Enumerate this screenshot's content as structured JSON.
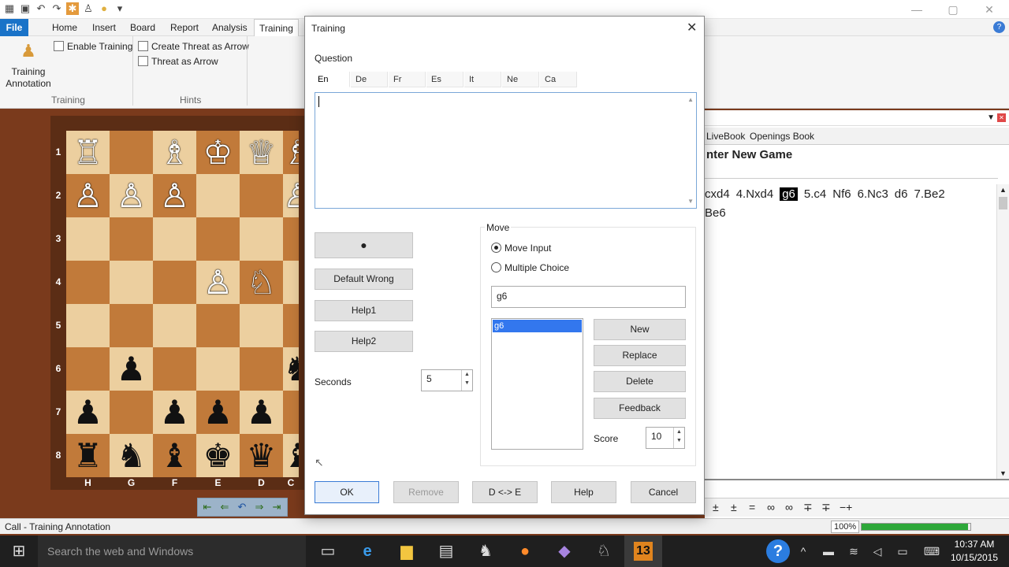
{
  "app": {
    "menu": [
      "File",
      "Home",
      "Insert",
      "Board",
      "Report",
      "Analysis",
      "Training"
    ],
    "ribbon": {
      "training_annotation": "Training Annotation",
      "enable_training": "Enable Training",
      "create_threat_arrow": "Create Threat as Arrow",
      "threat_as_arrow": "Threat as Arrow",
      "group_training": "Training",
      "group_hints": "Hints"
    },
    "status_text": "Call - Training Annotation",
    "zoom": "100%",
    "progress": 0.98
  },
  "board": {
    "ranks": [
      "1",
      "2",
      "3",
      "4",
      "5",
      "6",
      "7",
      "8"
    ],
    "files": [
      "H",
      "G",
      "F",
      "E",
      "D",
      "C"
    ],
    "pieces": [
      {
        "r": 0,
        "f": 0,
        "p": "♖",
        "c": "w"
      },
      {
        "r": 0,
        "f": 2,
        "p": "♗",
        "c": "w"
      },
      {
        "r": 0,
        "f": 3,
        "p": "♔",
        "c": "w"
      },
      {
        "r": 0,
        "f": 4,
        "p": "♕",
        "c": "w"
      },
      {
        "r": 0,
        "f": 5,
        "p": "♗",
        "c": "w"
      },
      {
        "r": 1,
        "f": 0,
        "p": "♙",
        "c": "w"
      },
      {
        "r": 1,
        "f": 1,
        "p": "♙",
        "c": "w"
      },
      {
        "r": 1,
        "f": 2,
        "p": "♙",
        "c": "w"
      },
      {
        "r": 1,
        "f": 5,
        "p": "♙",
        "c": "w"
      },
      {
        "r": 3,
        "f": 3,
        "p": "♙",
        "c": "w"
      },
      {
        "r": 3,
        "f": 4,
        "p": "♘",
        "c": "w"
      },
      {
        "r": 5,
        "f": 1,
        "p": "♟",
        "c": "b"
      },
      {
        "r": 5,
        "f": 5,
        "p": "♞",
        "c": "b"
      },
      {
        "r": 6,
        "f": 0,
        "p": "♟",
        "c": "b"
      },
      {
        "r": 6,
        "f": 2,
        "p": "♟",
        "c": "b"
      },
      {
        "r": 6,
        "f": 3,
        "p": "♟",
        "c": "b"
      },
      {
        "r": 6,
        "f": 4,
        "p": "♟",
        "c": "b"
      },
      {
        "r": 7,
        "f": 0,
        "p": "♜",
        "c": "b"
      },
      {
        "r": 7,
        "f": 1,
        "p": "♞",
        "c": "b"
      },
      {
        "r": 7,
        "f": 2,
        "p": "♝",
        "c": "b"
      },
      {
        "r": 7,
        "f": 3,
        "p": "♚",
        "c": "b"
      },
      {
        "r": 7,
        "f": 4,
        "p": "♛",
        "c": "b"
      },
      {
        "r": 7,
        "f": 5,
        "p": "♝",
        "c": "b"
      }
    ]
  },
  "notation": {
    "tabs": [
      "LiveBook",
      "Openings Book"
    ],
    "heading": "nter New Game",
    "moves_line1": [
      "cxd4",
      "4.Nxd4",
      "g6",
      "5.c4",
      "Nf6",
      "6.Nc3",
      "d6",
      "7.Be2"
    ],
    "selected_move": "g6",
    "moves_line2": "Be6",
    "symbols": [
      "±",
      "±",
      "=",
      "∞",
      "∞",
      "∓",
      "∓",
      "−+"
    ]
  },
  "dialog": {
    "title": "Training",
    "question_label": "Question",
    "lang_tabs": [
      "En",
      "De",
      "Fr",
      "Es",
      "It",
      "Ne",
      "Ca"
    ],
    "active_tab": "En",
    "question_text": "",
    "default_wrong": "Default Wrong",
    "help1": "Help1",
    "help2": "Help2",
    "seconds_label": "Seconds",
    "seconds_value": "5",
    "move_group": "Move",
    "move_input": "Move Input",
    "multiple_choice": "Multiple Choice",
    "move_field": "g6",
    "move_list": [
      "g6"
    ],
    "new": "New",
    "replace": "Replace",
    "delete": "Delete",
    "feedback": "Feedback",
    "score_label": "Score",
    "score_value": "10",
    "ok": "OK",
    "remove": "Remove",
    "swap": "D <-> E",
    "help": "Help",
    "cancel": "Cancel"
  },
  "taskbar": {
    "search_placeholder": "Search the web and Windows",
    "time": "10:37 AM",
    "date": "10/15/2015",
    "chessbase_version": "13"
  }
}
